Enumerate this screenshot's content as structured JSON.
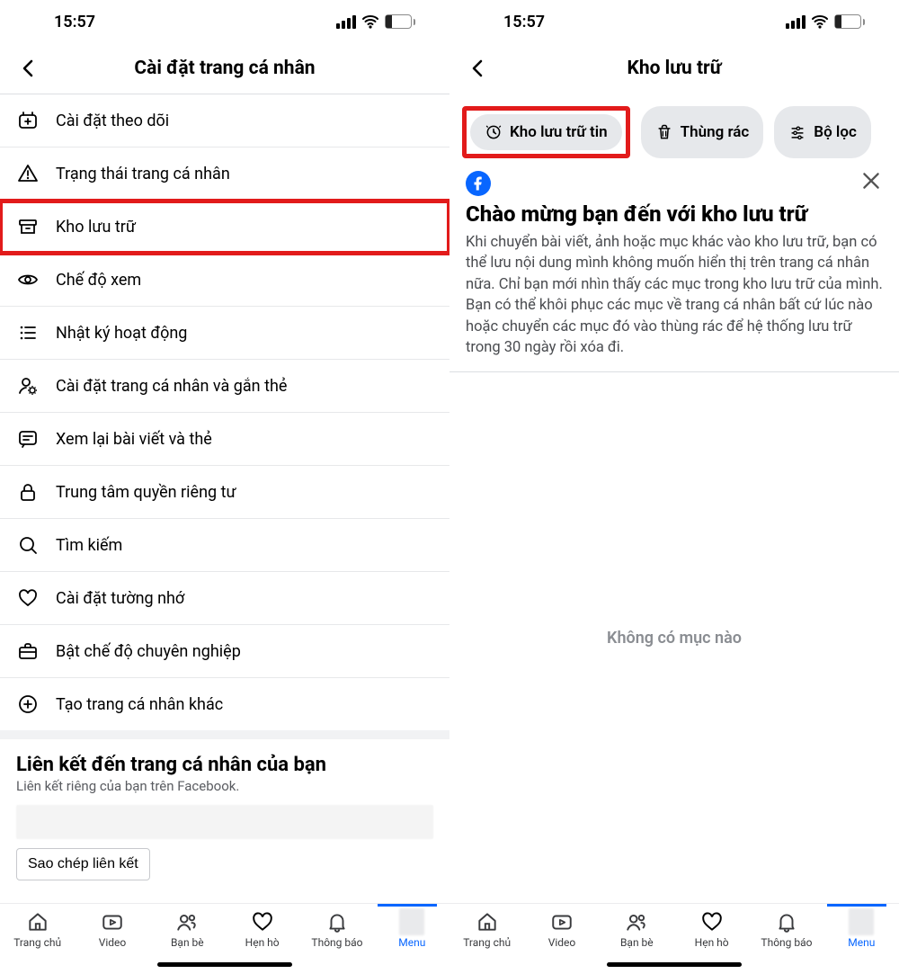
{
  "status": {
    "time": "15:57",
    "battery": "22"
  },
  "left": {
    "title": "Cài đặt trang cá nhân",
    "items": [
      {
        "key": "follow",
        "label": "Cài đặt theo dõi"
      },
      {
        "key": "status",
        "label": "Trạng thái trang cá nhân"
      },
      {
        "key": "archive",
        "label": "Kho lưu trữ"
      },
      {
        "key": "viewmode",
        "label": "Chế độ xem"
      },
      {
        "key": "activity",
        "label": "Nhật ký hoạt động"
      },
      {
        "key": "tagging",
        "label": "Cài đặt trang cá nhân và gắn thẻ"
      },
      {
        "key": "review",
        "label": "Xem lại bài viết và thẻ"
      },
      {
        "key": "privacy",
        "label": "Trung tâm quyền riêng tư"
      },
      {
        "key": "search",
        "label": "Tìm kiếm"
      },
      {
        "key": "memorial",
        "label": "Cài đặt tường nhớ"
      },
      {
        "key": "pro",
        "label": "Bật chế độ chuyên nghiệp"
      },
      {
        "key": "create",
        "label": "Tạo trang cá nhân khác"
      }
    ],
    "link_section_title": "Liên kết đến trang cá nhân của bạn",
    "link_section_sub": "Liên kết riêng của bạn trên Facebook.",
    "copy_button": "Sao chép liên kết"
  },
  "right": {
    "title": "Kho lưu trữ",
    "chip_archive": "Kho lưu trữ tin",
    "chip_trash": "Thùng rác",
    "chip_filter": "Bộ lọc",
    "welcome_title": "Chào mừng bạn đến với kho lưu trữ",
    "welcome_body": "Khi chuyển bài viết, ảnh hoặc mục khác vào kho lưu trữ, bạn có thể lưu nội dung mình không muốn hiển thị trên trang cá nhân nữa. Chỉ bạn mới nhìn thấy các mục trong kho lưu trữ của mình. Bạn có thể khôi phục các mục về trang cá nhân bất cứ lúc nào hoặc chuyển các mục đó vào thùng rác để hệ thống lưu trữ trong 30 ngày rồi xóa đi.",
    "empty": "Không có mục nào"
  },
  "tabs": {
    "home": "Trang chủ",
    "video": "Video",
    "friends": "Bạn bè",
    "dating": "Hẹn hò",
    "notifications": "Thông báo",
    "menu": "Menu"
  }
}
